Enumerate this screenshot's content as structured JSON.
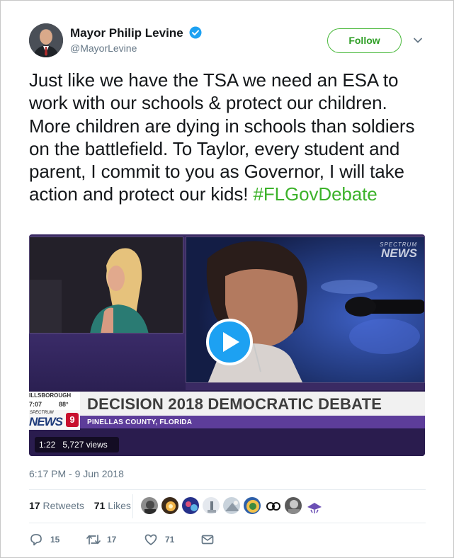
{
  "author": {
    "display_name": "Mayor Philip Levine",
    "handle": "@MayorLevine",
    "verified_icon": "verified-badge-icon",
    "follow_label": "Follow"
  },
  "tweet": {
    "text_main": "Just like we have the TSA we need an ESA to work with our schools & protect our children. More children are dying in schools than soldiers on the battlefield. To Taylor, every student and parent, I commit to you as Governor, I will take action and protect our kids! ",
    "hashtag": "#FLGovDebate"
  },
  "video": {
    "channel_logo_top": "SPECTRUM",
    "channel_logo_bottom": "NEWS",
    "lower_third_title": "DECISION 2018 DEMOCRATIC DEBATE",
    "lower_third_subtitle": "PINELLAS COUNTY, FLORIDA",
    "station_location": "ILLSBOROUGH",
    "station_time": "7:07",
    "station_temp": "88°",
    "station_brand_top": "SPECTRUM",
    "station_brand_bottom": "NEWS",
    "station_badge": "9",
    "duration": "1:22",
    "views": "5,727 views"
  },
  "timestamp": "6:17 PM - 9 Jun 2018",
  "stats": {
    "retweets_count": "17",
    "retweets_label": "Retweets",
    "likes_count": "71",
    "likes_label": "Likes"
  },
  "actions": {
    "reply_count": "15",
    "retweet_count": "17",
    "like_count": "71"
  },
  "colors": {
    "follow_green": "#4ab93c",
    "hashtag_green": "#3cb22a",
    "secondary_text": "#657786",
    "play_blue": "#1da1f2"
  }
}
